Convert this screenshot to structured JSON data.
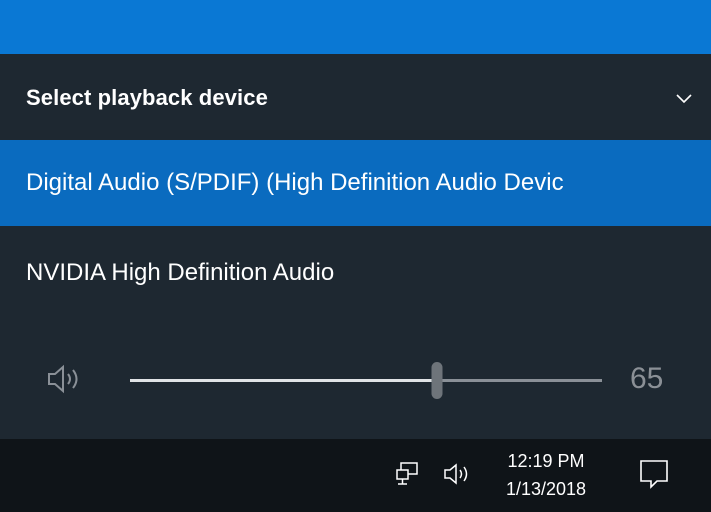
{
  "flyout": {
    "title": "Select playback device",
    "devices": [
      {
        "label": "Digital Audio (S/PDIF) (High Definition Audio Devic",
        "selected": true
      },
      {
        "label": "NVIDIA High Definition Audio",
        "selected": false
      }
    ],
    "volume": {
      "value": "65",
      "level": 0.65
    }
  },
  "taskbar": {
    "time": "12:19 PM",
    "date": "1/13/2018",
    "icons": [
      "network-icon",
      "speaker-icon",
      "action-center-icon"
    ]
  },
  "colors": {
    "accent": "#0a78d4",
    "selection": "#0a6bbf",
    "flyout_bg": "#1e2831",
    "taskbar_bg": "#0f1418"
  }
}
